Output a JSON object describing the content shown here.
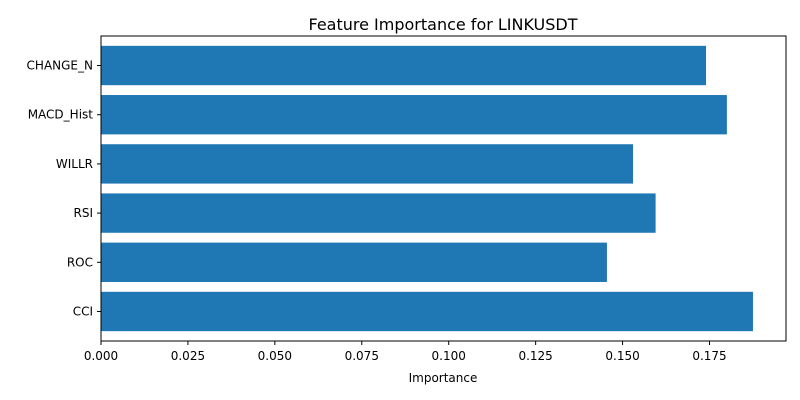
{
  "chart_data": {
    "type": "bar",
    "orientation": "horizontal",
    "title": "Feature Importance for LINKUSDT",
    "xlabel": "Importance",
    "ylabel": "",
    "categories": [
      "CHANGE_N",
      "MACD_Hist",
      "WILLR",
      "RSI",
      "ROC",
      "CCI"
    ],
    "values": [
      0.174,
      0.18,
      0.153,
      0.1595,
      0.1455,
      0.1875
    ],
    "xlim": [
      0,
      0.197
    ],
    "xticks": [
      0.0,
      0.025,
      0.05,
      0.075,
      0.1,
      0.125,
      0.15,
      0.175
    ],
    "xtick_labels": [
      "0.000",
      "0.025",
      "0.050",
      "0.075",
      "0.100",
      "0.125",
      "0.150",
      "0.175"
    ],
    "grid": false,
    "bar_color": "#1f77b4"
  }
}
